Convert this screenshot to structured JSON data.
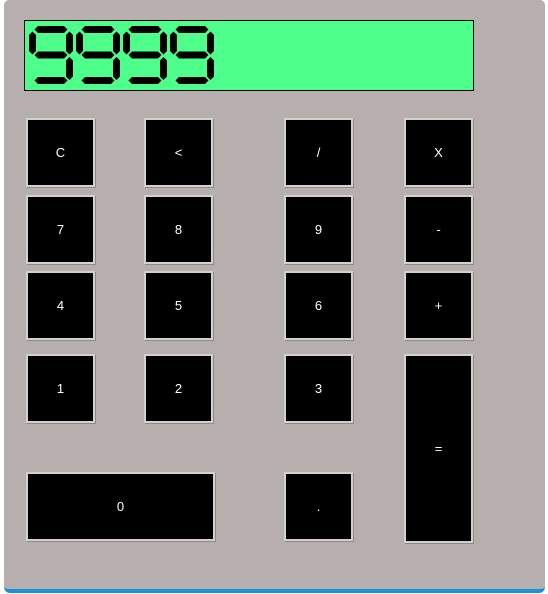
{
  "display": {
    "value": "9999",
    "background_color": "#4efe8a",
    "digit_color": "#000000"
  },
  "keys": {
    "clear": "C",
    "backspace": "<",
    "divide": "/",
    "multiply": "X",
    "seven": "7",
    "eight": "8",
    "nine": "9",
    "subtract": "-",
    "four": "4",
    "five": "5",
    "six": "6",
    "add": "+",
    "one": "1",
    "two": "2",
    "three": "3",
    "equals": "=",
    "zero": "0",
    "decimal": "."
  },
  "colors": {
    "body": "#b7aeae",
    "key_background": "#000000",
    "key_text": "#ffffff",
    "bottom_accent": "#1e90d3"
  }
}
